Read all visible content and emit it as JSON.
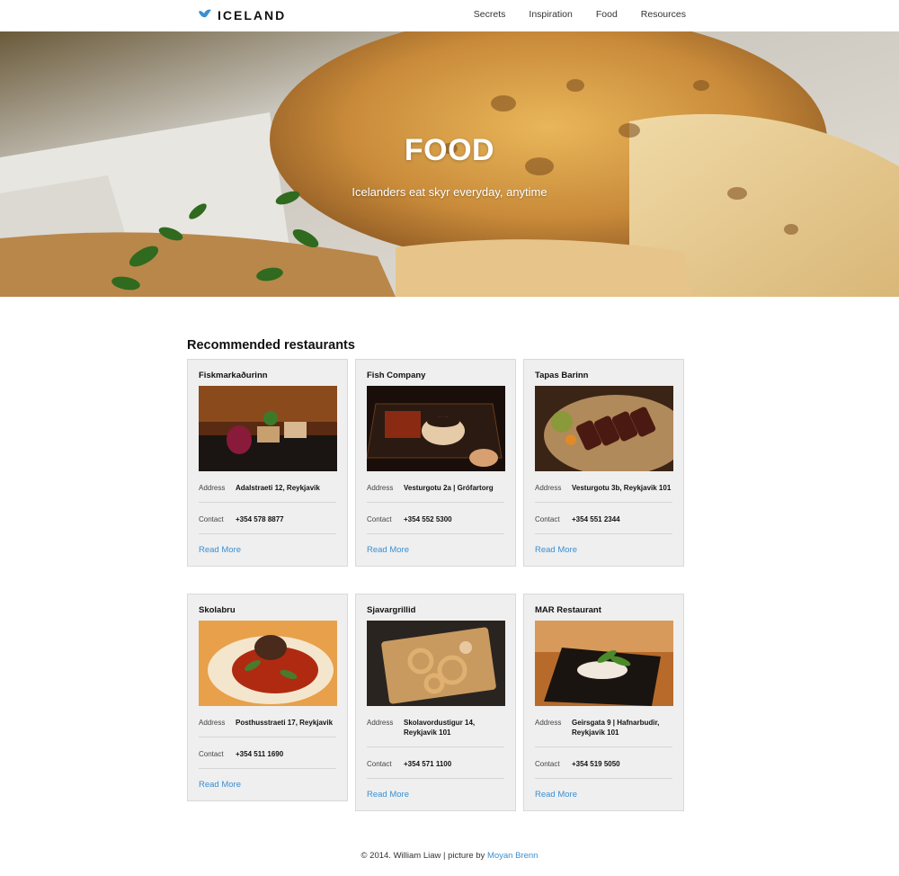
{
  "brand": {
    "name": "ICELAND",
    "icon": "bird-logo-icon",
    "accent": "#3b8fd1"
  },
  "nav": {
    "items": [
      "Secrets",
      "Inspiration",
      "Food",
      "Resources"
    ]
  },
  "hero": {
    "title": "FOOD",
    "subtitle": "Icelanders eat skyr everyday, anytime"
  },
  "section": {
    "title": "Recommended restaurants"
  },
  "labels": {
    "address": "Address",
    "contact": "Contact",
    "read_more": "Read More"
  },
  "restaurants": [
    {
      "name": "Fiskmarkaðurinn",
      "address": "Adalstraeti 12, Reykjavik",
      "contact": "+354 578 8877"
    },
    {
      "name": "Fish Company",
      "address": "Vesturgotu 2a | Grófartorg",
      "contact": "+354 552 5300"
    },
    {
      "name": "Tapas Barinn",
      "address": "Vesturgotu 3b, Reykjavik 101",
      "contact": "+354 551 2344"
    },
    {
      "name": "Skolabru",
      "address": "Posthusstraeti 17, Reykjavik",
      "contact": "+354 511 1690"
    },
    {
      "name": "Sjavargrillid",
      "address": "Skolavordustigur 14, Reykjavik 101",
      "contact": "+354 571 1100"
    },
    {
      "name": "MAR Restaurant",
      "address": "Geirsgata 9 | Hafnarbudir, Reykjavik 101",
      "contact": "+354 519 5050"
    }
  ],
  "footer": {
    "text": "© 2014. William Liaw | picture by",
    "credit": "Moyan Brenn"
  }
}
